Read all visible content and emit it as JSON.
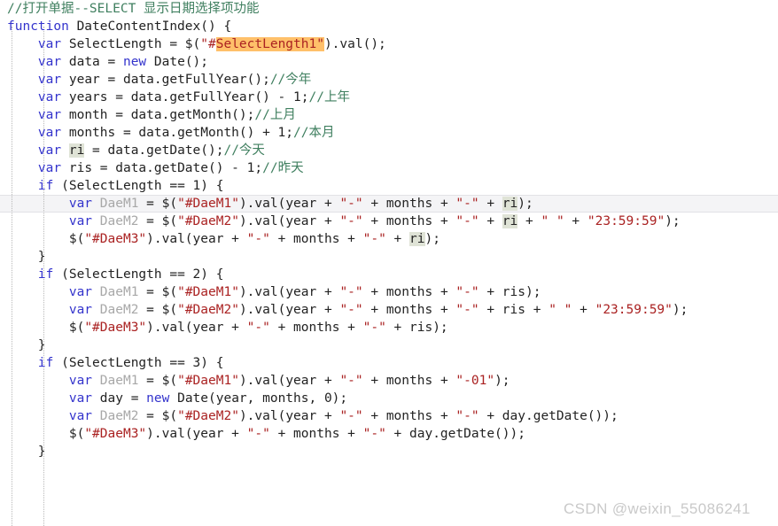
{
  "editor": {
    "language": "javascript",
    "font_size_px": 14.5,
    "line_height_px": 20,
    "current_line_number": 12,
    "colors": {
      "background": "#ffffff",
      "default_text": "#222222",
      "comment": "#3f7f5f",
      "keyword": "#3333cc",
      "string": "#aa2222",
      "dim_identifier": "#a8a8a8",
      "occurrence_highlight": "#dfe3d6",
      "search_highlight": "#ffc06a",
      "current_line_band": "#f4f4f6",
      "indent_guide": "#b9b9b9",
      "watermark": "#c9c9c9"
    },
    "highlighted_token": "#SelectLength1\"",
    "occurrence_token": "ri"
  },
  "watermark": {
    "text": "CSDN @weixin_55086241"
  },
  "code": {
    "lines": [
      {
        "n": 1,
        "indent": 0,
        "tokens": [
          {
            "t": "//打开单据--SELECT 显示日期选择项功能",
            "c": "cmt"
          }
        ]
      },
      {
        "n": 2,
        "indent": 0,
        "tokens": [
          {
            "t": "function",
            "c": "kw"
          },
          {
            "t": " DateContentIndex() {",
            "c": "id"
          }
        ]
      },
      {
        "n": 3,
        "indent": 1,
        "tokens": [
          {
            "t": "var",
            "c": "kw"
          },
          {
            "t": " SelectLength = $(",
            "c": "id"
          },
          {
            "t": "\"#",
            "c": "str"
          },
          {
            "t": "SelectLength1\"",
            "c": "sel-str"
          },
          {
            "t": ").val();",
            "c": "id"
          }
        ]
      },
      {
        "n": 4,
        "indent": 1,
        "tokens": [
          {
            "t": "var",
            "c": "kw"
          },
          {
            "t": " data = ",
            "c": "id"
          },
          {
            "t": "new",
            "c": "kw"
          },
          {
            "t": " Date();",
            "c": "id"
          }
        ]
      },
      {
        "n": 5,
        "indent": 1,
        "tokens": [
          {
            "t": "var",
            "c": "kw"
          },
          {
            "t": " year = data.getFullYear();",
            "c": "id"
          },
          {
            "t": "//今年",
            "c": "cmt"
          }
        ]
      },
      {
        "n": 6,
        "indent": 1,
        "tokens": [
          {
            "t": "var",
            "c": "kw"
          },
          {
            "t": " years = data.getFullYear() - 1;",
            "c": "id"
          },
          {
            "t": "//上年",
            "c": "cmt"
          }
        ]
      },
      {
        "n": 7,
        "indent": 1,
        "tokens": [
          {
            "t": "var",
            "c": "kw"
          },
          {
            "t": " month = data.getMonth();",
            "c": "id"
          },
          {
            "t": "//上月",
            "c": "cmt"
          }
        ]
      },
      {
        "n": 8,
        "indent": 1,
        "tokens": [
          {
            "t": "var",
            "c": "kw"
          },
          {
            "t": " months = data.getMonth() + 1;",
            "c": "id"
          },
          {
            "t": "//本月",
            "c": "cmt"
          }
        ]
      },
      {
        "n": 9,
        "indent": 1,
        "tokens": [
          {
            "t": "var",
            "c": "kw"
          },
          {
            "t": " ",
            "c": "id"
          },
          {
            "t": "ri",
            "c": "occ"
          },
          {
            "t": " = data.getDate();",
            "c": "id"
          },
          {
            "t": "//今天",
            "c": "cmt"
          }
        ]
      },
      {
        "n": 10,
        "indent": 1,
        "tokens": [
          {
            "t": "var",
            "c": "kw"
          },
          {
            "t": " ris = data.getDate() - 1;",
            "c": "id"
          },
          {
            "t": "//昨天",
            "c": "cmt"
          }
        ]
      },
      {
        "n": 11,
        "indent": 1,
        "tokens": [
          {
            "t": "if",
            "c": "kw"
          },
          {
            "t": " (SelectLength == 1) {",
            "c": "id"
          }
        ]
      },
      {
        "n": 12,
        "indent": 2,
        "tokens": [
          {
            "t": "var",
            "c": "kw"
          },
          {
            "t": " ",
            "c": "id"
          },
          {
            "t": "DaeM1",
            "c": "gray"
          },
          {
            "t": " = $(",
            "c": "id"
          },
          {
            "t": "\"#DaeM1\"",
            "c": "str"
          },
          {
            "t": ").val(year + ",
            "c": "id"
          },
          {
            "t": "\"-\"",
            "c": "str"
          },
          {
            "t": " + months + ",
            "c": "id"
          },
          {
            "t": "\"-\"",
            "c": "str"
          },
          {
            "t": " + ",
            "c": "id"
          },
          {
            "t": "ri",
            "c": "occ"
          },
          {
            "t": ");",
            "c": "id"
          }
        ]
      },
      {
        "n": 13,
        "indent": 2,
        "tokens": [
          {
            "t": "var",
            "c": "kw"
          },
          {
            "t": " ",
            "c": "id"
          },
          {
            "t": "DaeM2",
            "c": "gray"
          },
          {
            "t": " = $(",
            "c": "id"
          },
          {
            "t": "\"#DaeM2\"",
            "c": "str"
          },
          {
            "t": ").val(year + ",
            "c": "id"
          },
          {
            "t": "\"-\"",
            "c": "str"
          },
          {
            "t": " + months + ",
            "c": "id"
          },
          {
            "t": "\"-\"",
            "c": "str"
          },
          {
            "t": " + ",
            "c": "id"
          },
          {
            "t": "ri",
            "c": "occ"
          },
          {
            "t": " + ",
            "c": "id"
          },
          {
            "t": "\" \"",
            "c": "str"
          },
          {
            "t": " + ",
            "c": "id"
          },
          {
            "t": "\"23:59:59\"",
            "c": "str"
          },
          {
            "t": ");",
            "c": "id"
          }
        ]
      },
      {
        "n": 14,
        "indent": 2,
        "tokens": [
          {
            "t": "$(",
            "c": "id"
          },
          {
            "t": "\"#DaeM3\"",
            "c": "str"
          },
          {
            "t": ").val(year + ",
            "c": "id"
          },
          {
            "t": "\"-\"",
            "c": "str"
          },
          {
            "t": " + months + ",
            "c": "id"
          },
          {
            "t": "\"-\"",
            "c": "str"
          },
          {
            "t": " + ",
            "c": "id"
          },
          {
            "t": "ri",
            "c": "occ"
          },
          {
            "t": ");",
            "c": "id"
          }
        ]
      },
      {
        "n": 15,
        "indent": 1,
        "tokens": [
          {
            "t": "}",
            "c": "id"
          }
        ]
      },
      {
        "n": 16,
        "indent": 1,
        "tokens": [
          {
            "t": "if",
            "c": "kw"
          },
          {
            "t": " (SelectLength == 2) {",
            "c": "id"
          }
        ]
      },
      {
        "n": 17,
        "indent": 2,
        "tokens": [
          {
            "t": "var",
            "c": "kw"
          },
          {
            "t": " ",
            "c": "id"
          },
          {
            "t": "DaeM1",
            "c": "gray"
          },
          {
            "t": " = $(",
            "c": "id"
          },
          {
            "t": "\"#DaeM1\"",
            "c": "str"
          },
          {
            "t": ").val(year + ",
            "c": "id"
          },
          {
            "t": "\"-\"",
            "c": "str"
          },
          {
            "t": " + months + ",
            "c": "id"
          },
          {
            "t": "\"-\"",
            "c": "str"
          },
          {
            "t": " + ris);",
            "c": "id"
          }
        ]
      },
      {
        "n": 18,
        "indent": 2,
        "tokens": [
          {
            "t": "var",
            "c": "kw"
          },
          {
            "t": " ",
            "c": "id"
          },
          {
            "t": "DaeM2",
            "c": "gray"
          },
          {
            "t": " = $(",
            "c": "id"
          },
          {
            "t": "\"#DaeM2\"",
            "c": "str"
          },
          {
            "t": ").val(year + ",
            "c": "id"
          },
          {
            "t": "\"-\"",
            "c": "str"
          },
          {
            "t": " + months + ",
            "c": "id"
          },
          {
            "t": "\"-\"",
            "c": "str"
          },
          {
            "t": " + ris + ",
            "c": "id"
          },
          {
            "t": "\" \"",
            "c": "str"
          },
          {
            "t": " + ",
            "c": "id"
          },
          {
            "t": "\"23:59:59\"",
            "c": "str"
          },
          {
            "t": ");",
            "c": "id"
          }
        ]
      },
      {
        "n": 19,
        "indent": 2,
        "tokens": [
          {
            "t": "$(",
            "c": "id"
          },
          {
            "t": "\"#DaeM3\"",
            "c": "str"
          },
          {
            "t": ").val(year + ",
            "c": "id"
          },
          {
            "t": "\"-\"",
            "c": "str"
          },
          {
            "t": " + months + ",
            "c": "id"
          },
          {
            "t": "\"-\"",
            "c": "str"
          },
          {
            "t": " + ris);",
            "c": "id"
          }
        ]
      },
      {
        "n": 20,
        "indent": 1,
        "tokens": [
          {
            "t": "}",
            "c": "id"
          }
        ]
      },
      {
        "n": 21,
        "indent": 1,
        "tokens": [
          {
            "t": "if",
            "c": "kw"
          },
          {
            "t": " (SelectLength == 3) {",
            "c": "id"
          }
        ]
      },
      {
        "n": 22,
        "indent": 2,
        "tokens": [
          {
            "t": "var",
            "c": "kw"
          },
          {
            "t": " ",
            "c": "id"
          },
          {
            "t": "DaeM1",
            "c": "gray"
          },
          {
            "t": " = $(",
            "c": "id"
          },
          {
            "t": "\"#DaeM1\"",
            "c": "str"
          },
          {
            "t": ").val(year + ",
            "c": "id"
          },
          {
            "t": "\"-\"",
            "c": "str"
          },
          {
            "t": " + months + ",
            "c": "id"
          },
          {
            "t": "\"-01\"",
            "c": "str"
          },
          {
            "t": ");",
            "c": "id"
          }
        ]
      },
      {
        "n": 23,
        "indent": 2,
        "tokens": [
          {
            "t": "var",
            "c": "kw"
          },
          {
            "t": " day = ",
            "c": "id"
          },
          {
            "t": "new",
            "c": "kw"
          },
          {
            "t": " Date(year, months, 0);",
            "c": "id"
          }
        ]
      },
      {
        "n": 24,
        "indent": 2,
        "tokens": [
          {
            "t": "var",
            "c": "kw"
          },
          {
            "t": " ",
            "c": "id"
          },
          {
            "t": "DaeM2",
            "c": "gray"
          },
          {
            "t": " = $(",
            "c": "id"
          },
          {
            "t": "\"#DaeM2\"",
            "c": "str"
          },
          {
            "t": ").val(year + ",
            "c": "id"
          },
          {
            "t": "\"-\"",
            "c": "str"
          },
          {
            "t": " + months + ",
            "c": "id"
          },
          {
            "t": "\"-\"",
            "c": "str"
          },
          {
            "t": " + day.getDate());",
            "c": "id"
          }
        ]
      },
      {
        "n": 25,
        "indent": 2,
        "tokens": [
          {
            "t": "$(",
            "c": "id"
          },
          {
            "t": "\"#DaeM3\"",
            "c": "str"
          },
          {
            "t": ").val(year + ",
            "c": "id"
          },
          {
            "t": "\"-\"",
            "c": "str"
          },
          {
            "t": " + months + ",
            "c": "id"
          },
          {
            "t": "\"-\"",
            "c": "str"
          },
          {
            "t": " + day.getDate());",
            "c": "id"
          }
        ]
      },
      {
        "n": 26,
        "indent": 1,
        "tokens": [
          {
            "t": "}",
            "c": "id"
          }
        ]
      }
    ]
  }
}
